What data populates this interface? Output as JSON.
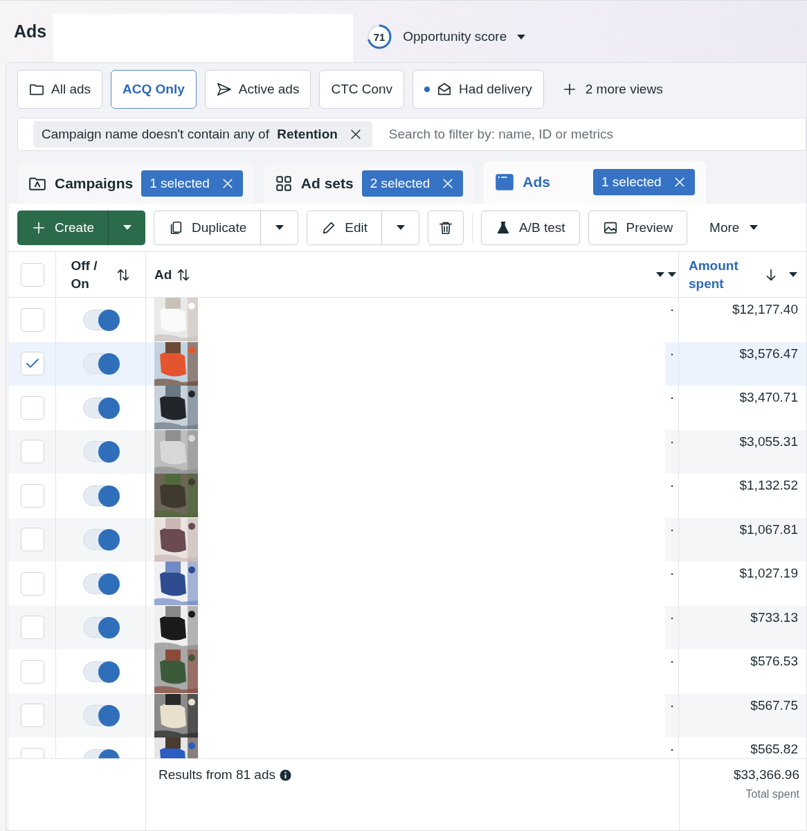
{
  "header": {
    "title": "Ads",
    "opportunity": {
      "score": "71",
      "label": "Opportunity score"
    }
  },
  "views": [
    {
      "label": "All ads",
      "kind": "folder",
      "selected": false
    },
    {
      "label": "ACQ Only",
      "kind": "plain",
      "selected": true
    },
    {
      "label": "Active ads",
      "kind": "send",
      "selected": false
    },
    {
      "label": "CTC Conv",
      "kind": "plain",
      "selected": false
    },
    {
      "label": "Had delivery",
      "kind": "mail",
      "selected": false
    }
  ],
  "more_views": "2 more views",
  "filter": {
    "chip": "Campaign name doesn't contain any of **Retention**",
    "placeholder": "Search to filter by: name, ID or metrics"
  },
  "levels": [
    {
      "label": "Campaigns",
      "badge": "1 selected",
      "kind": "campaign",
      "selected": false
    },
    {
      "label": "Ad sets",
      "badge": "2 selected",
      "kind": "adset",
      "selected": false
    },
    {
      "label": "Ads",
      "badge": "1 selected",
      "kind": "ad",
      "selected": true
    }
  ],
  "toolbar": {
    "create": "Create",
    "duplicate": "Duplicate",
    "edit": "Edit",
    "ab_test": "A/B test",
    "preview": "Preview",
    "more": "More"
  },
  "table": {
    "select_all_checked": false,
    "columns": [
      {
        "label": "Off / On"
      },
      {
        "label": "Ad"
      },
      {
        "label": "Amount spent"
      }
    ],
    "rows": [
      {
        "amount": "$12,177.40",
        "checked": false,
        "on": true
      },
      {
        "amount": "$3,576.47",
        "checked": true,
        "on": true
      },
      {
        "amount": "$3,470.71",
        "checked": false,
        "on": true
      },
      {
        "amount": "$3,055.31",
        "checked": false,
        "on": true
      },
      {
        "amount": "$1,132.52",
        "checked": false,
        "on": true
      },
      {
        "amount": "$1,067.81",
        "checked": false,
        "on": true
      },
      {
        "amount": "$1,027.19",
        "checked": false,
        "on": true
      },
      {
        "amount": "$733.13",
        "checked": false,
        "on": true
      },
      {
        "amount": "$576.53",
        "checked": false,
        "on": true
      },
      {
        "amount": "$567.75",
        "checked": false,
        "on": true
      },
      {
        "amount": "$565.82",
        "checked": false,
        "on": true
      }
    ],
    "footer": {
      "results": "Results from 81 ads",
      "total": "$33,366.96",
      "total_label": "Total spent"
    }
  }
}
